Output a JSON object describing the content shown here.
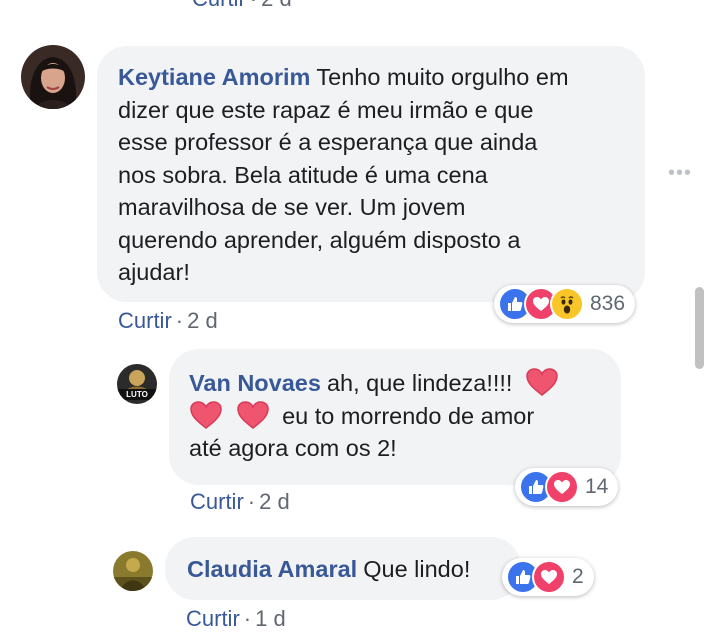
{
  "top_meta": {
    "action": "Curtir",
    "time": "2 d"
  },
  "comments": [
    {
      "author": "Keytiane Amorim",
      "lines": [
        "Tenho muito orgulho em",
        "dizer que este rapaz é meu irmão e que",
        "esse professor é a esperança que ainda",
        "nos sobra. Bela atitude é uma cena",
        "maravilhosa de se ver. Um jovem",
        "querendo aprender, alguém disposto a",
        "ajudar!"
      ],
      "reactions": [
        "like",
        "love",
        "wow"
      ],
      "reaction_count": "836",
      "action": "Curtir",
      "time": "2 d"
    },
    {
      "author": "Van Novaes",
      "text_line1": "ah, que lindeza!!!!",
      "text_line2": "eu to morrendo de amor",
      "text_line3": "até agora com os 2!",
      "avatar_text": "LUTO",
      "reactions": [
        "like",
        "love"
      ],
      "reaction_count": "14",
      "action": "Curtir",
      "time": "2 d"
    },
    {
      "author": "Claudia Amaral",
      "text": "Que lindo!",
      "reactions": [
        "like",
        "love"
      ],
      "reaction_count": "2",
      "action": "Curtir",
      "time": "1 d"
    }
  ],
  "icons": {
    "more": "more-options-icon",
    "like": "like-reaction-icon",
    "love": "love-reaction-icon",
    "wow": "wow-reaction-icon",
    "heart_emoji": "heart-emoji-icon"
  },
  "colors": {
    "link": "#385898",
    "bubble": "#f2f3f5",
    "meta": "#606770",
    "like": "#3b73ec",
    "love": "#f0416a",
    "wow": "#f9c62a"
  }
}
